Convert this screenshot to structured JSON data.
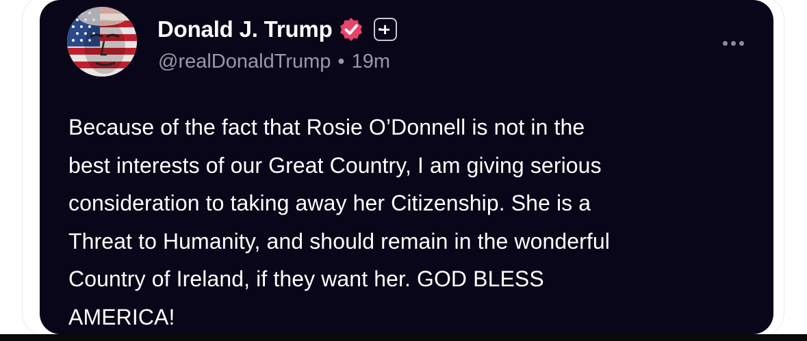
{
  "post": {
    "author": {
      "display_name": "Donald J. Trump",
      "handle": "@realDonaldTrump",
      "avatar_icon": "flag-face-avatar",
      "verified_icon": "verified-badge-icon",
      "verified_color": "#e8436a",
      "plus_badge": "+"
    },
    "separator": "•",
    "timestamp": "19m",
    "more_icon": "more-options-icon",
    "body_lines": [
      "Because of the fact that Rosie O’Donnell is not in the",
      "best interests of our Great Country, I am giving serious",
      "consideration to taking away her Citizenship. She is a",
      "Threat to Humanity, and should remain in the wonderful",
      "Country of Ireland, if they want her. GOD BLESS",
      "AMERICA!"
    ]
  },
  "colors": {
    "card_background": "#0a0619",
    "text_primary": "#ffffff",
    "text_secondary": "#9a99a6"
  }
}
